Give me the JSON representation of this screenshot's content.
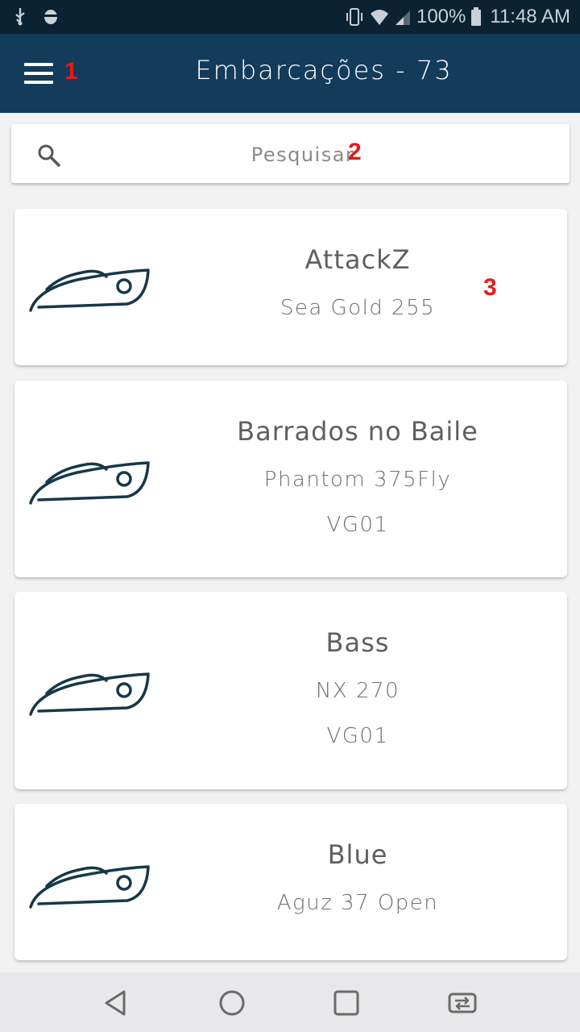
{
  "status_bar": {
    "battery": "100%",
    "time": "11:48 AM",
    "colors": {
      "background": "#0b2233"
    }
  },
  "app_bar": {
    "title": "Embarcações - 73",
    "menu_icon": "hamburger-menu-icon",
    "colors": {
      "background": "#123c5a"
    }
  },
  "search": {
    "placeholder": "Pesquisar",
    "icon": "search-icon"
  },
  "annotations": [
    "1",
    "2",
    "3"
  ],
  "boats": [
    {
      "name": "AttackZ",
      "model": "Sea Gold 255",
      "code": ""
    },
    {
      "name": "Barrados no Baile",
      "model": "Phantom 375Fly",
      "code": "VG01"
    },
    {
      "name": "Bass",
      "model": "NX 270",
      "code": "VG01"
    },
    {
      "name": "Blue",
      "model": "Aguz 37 Open",
      "code": ""
    }
  ],
  "nav_bar": {
    "buttons": [
      "back-icon",
      "home-icon",
      "recents-icon",
      "switch-app-icon"
    ]
  }
}
